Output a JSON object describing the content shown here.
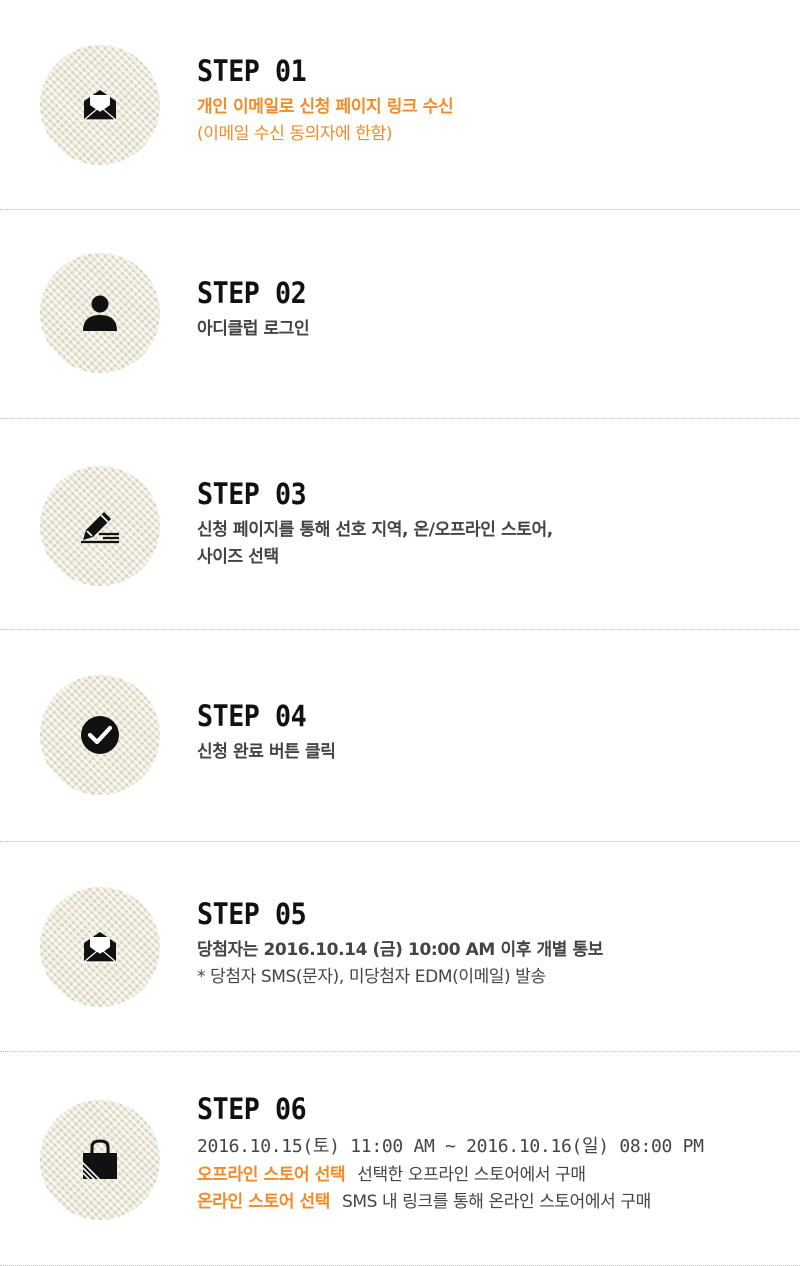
{
  "steps": [
    {
      "title": "STEP 01",
      "icon": "envelope-open-icon",
      "lines": [
        "개인 이메일로 신청 페이지 링크 수신",
        "(이메일 수신 동의자에 한함)"
      ]
    },
    {
      "title": "STEP 02",
      "icon": "user-icon",
      "lines": [
        "아디클럽 로그인"
      ]
    },
    {
      "title": "STEP 03",
      "icon": "pencil-icon",
      "lines": [
        "신청 페이지를 통해 선호 지역, 온/오프라인 스토어,",
        "사이즈 선택"
      ]
    },
    {
      "title": "STEP 04",
      "icon": "check-circle-icon",
      "lines": [
        "신청 완료 버튼 클릭"
      ]
    },
    {
      "title": "STEP 05",
      "icon": "envelope-open-icon",
      "lines": [
        "당첨자는 2016.10.14 (금) 10:00 AM 이후 개별 통보",
        "* 당첨자 SMS(문자), 미당첨자 EDM(이메일) 발송"
      ]
    },
    {
      "title": "STEP 06",
      "icon": "shopping-bag-icon",
      "date_range": "2016.10.15(토) 11:00 AM ~ 2016.10.16(일) 08:00 PM",
      "options": [
        {
          "tag": "오프라인 스토어 선택",
          "desc": "선택한 오프라인 스토어에서 구매"
        },
        {
          "tag": "온라인 스토어 선택",
          "desc": "SMS 내 링크를 통해 온라인 스토어에서 구매"
        }
      ]
    }
  ],
  "colors": {
    "accent": "#f28c28",
    "title": "#111111",
    "text": "#444444",
    "circle": "#ece8da",
    "divider": "#bfbfbf"
  }
}
